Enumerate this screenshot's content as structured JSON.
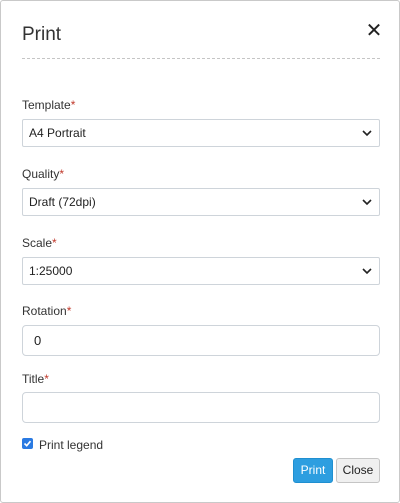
{
  "dialog": {
    "title": "Print",
    "close_icon": "close-icon"
  },
  "required_marker": "*",
  "template": {
    "label": "Template",
    "value": "A4 Portrait"
  },
  "quality": {
    "label": "Quality",
    "value": "Draft (72dpi)"
  },
  "scale": {
    "label": "Scale",
    "value": "1:25000"
  },
  "rotation": {
    "label": "Rotation",
    "value": "0"
  },
  "title_field": {
    "label": "Title",
    "value": ""
  },
  "print_legend": {
    "label": "Print legend",
    "checked": true
  },
  "buttons": {
    "print": "Print",
    "close": "Close"
  },
  "colors": {
    "accent": "#2d9ee0",
    "required": "#c0392b"
  }
}
